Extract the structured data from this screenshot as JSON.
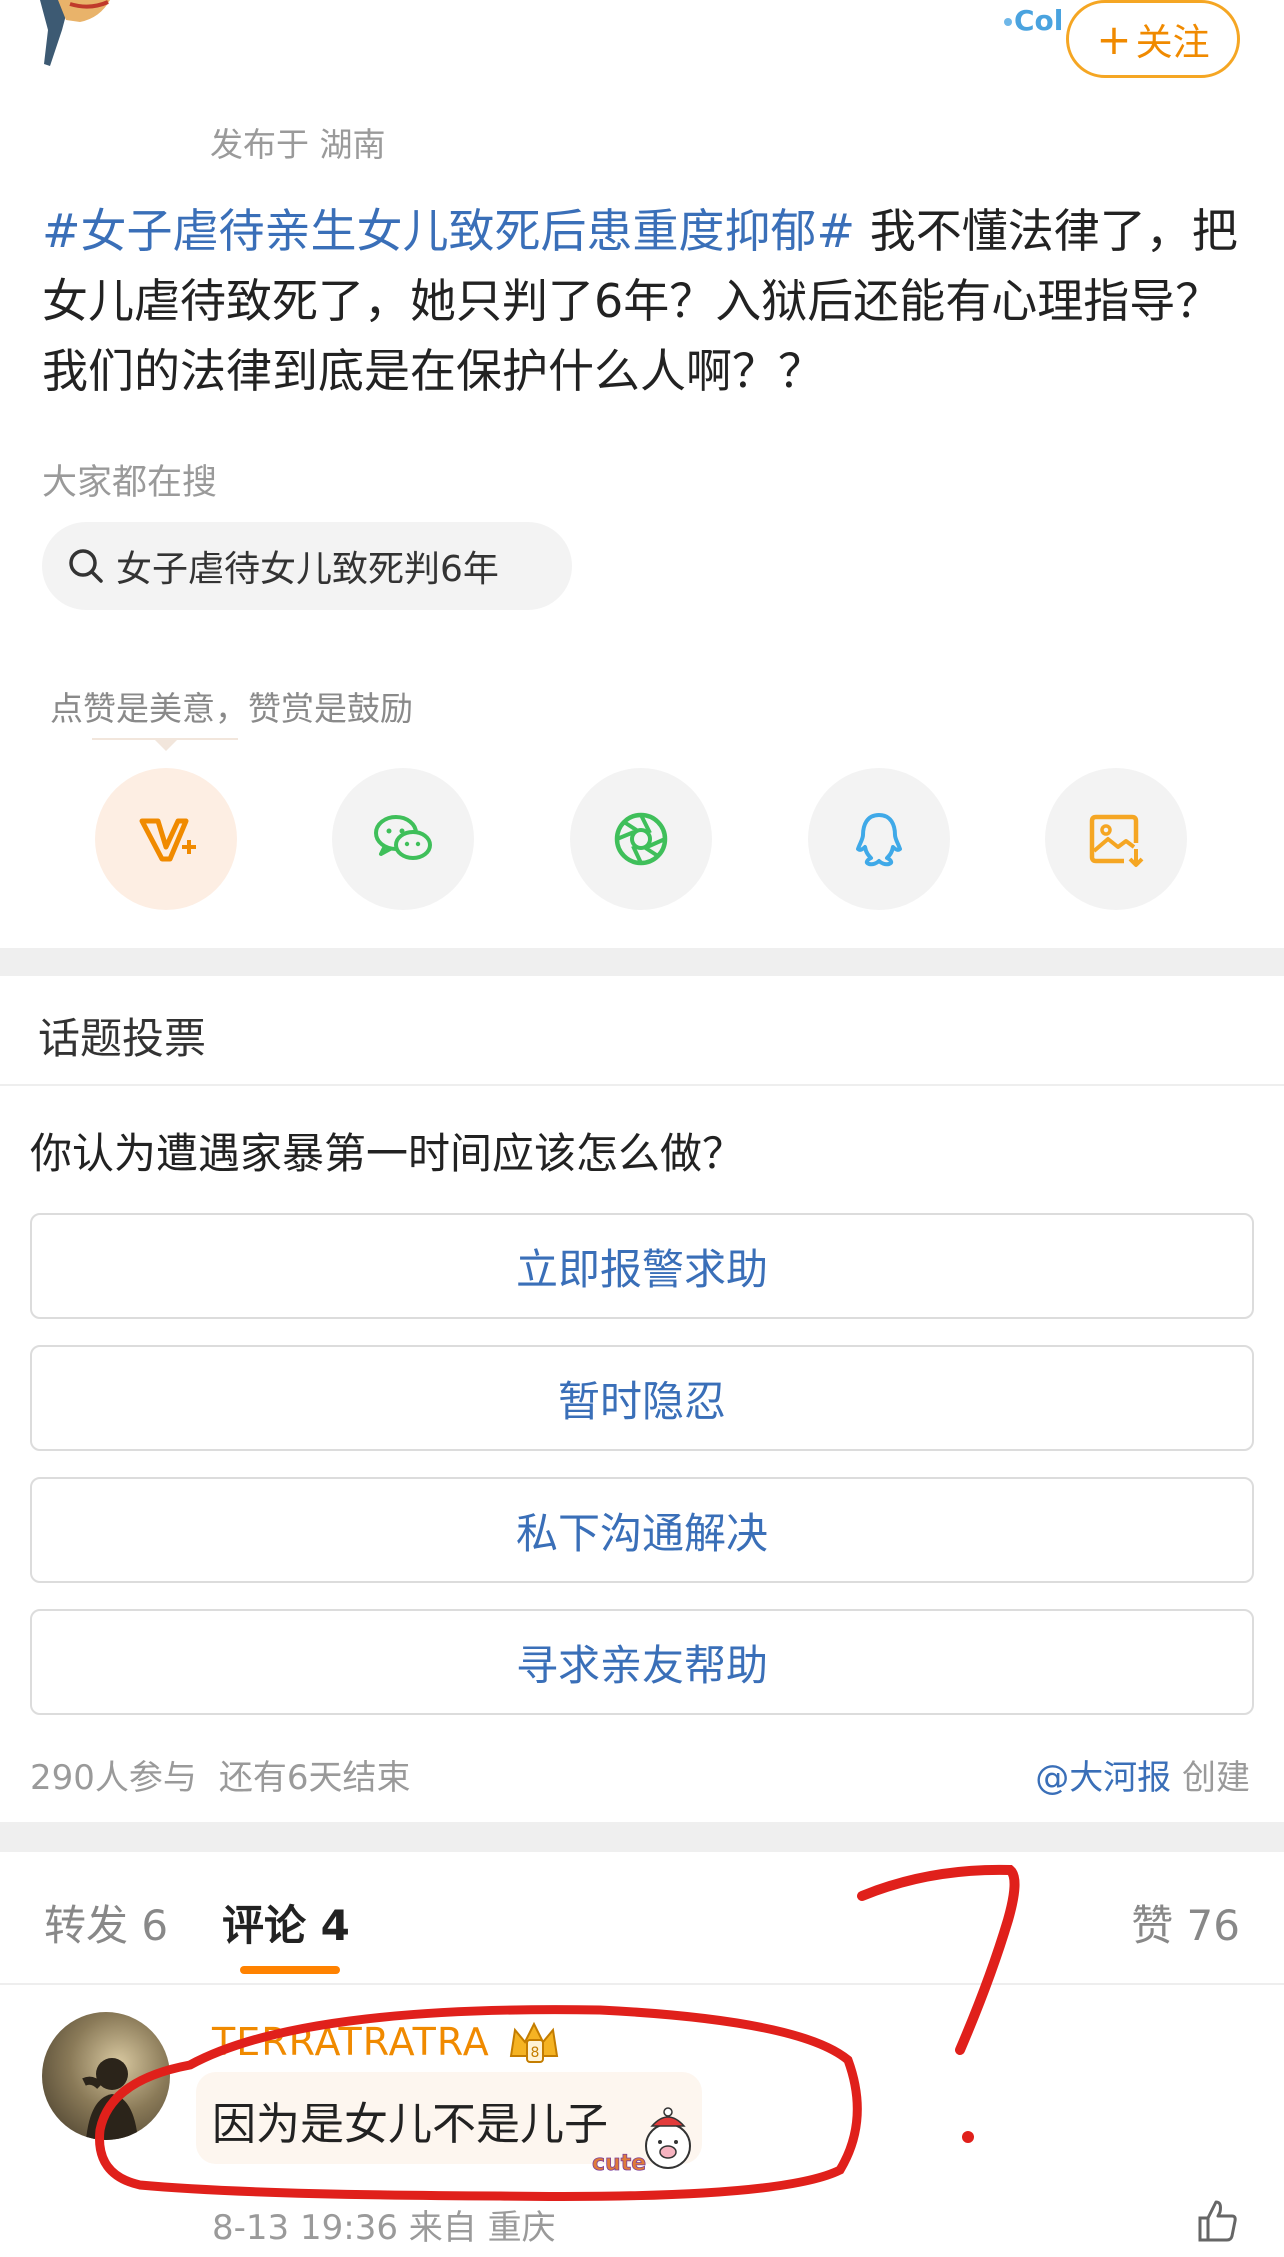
{
  "header": {
    "follow_label": "关注",
    "location": "发布于 湖南"
  },
  "post": {
    "topic": "#女子虐待亲生女儿致死后患重度抑郁#",
    "text": " 我不懂法律了，把女儿虐待致死了，她只判了6年？入狱后还能有心理指导？我们的法律到底是在保护什么人啊？？"
  },
  "search": {
    "label": "大家都在搜",
    "query": "女子虐待女儿致死判6年"
  },
  "reward": {
    "label": "点赞是美意，赞赏是鼓励"
  },
  "share_icons": [
    "reward-icon",
    "wechat-icon",
    "moments-icon",
    "qq-icon",
    "save-image-icon"
  ],
  "poll": {
    "title": "话题投票",
    "question": "你认为遭遇家暴第一时间应该怎么做？",
    "options": [
      "立即报警求助",
      "暂时隐忍",
      "私下沟通解决",
      "寻求亲友帮助"
    ],
    "participants": "290人参与",
    "remaining": "还有6天结束",
    "creator": "@大河报",
    "created_label": "创建"
  },
  "tabs": {
    "repost": "转发 6",
    "comments": "评论 4",
    "likes": "赞 76"
  },
  "comment": {
    "username": "TERRATRATRA",
    "text": "因为是女儿不是儿子",
    "sticker_label": "cute",
    "time": "8-13 19:36",
    "source": "来自 重庆"
  },
  "colors": {
    "accent": "#ff8200",
    "link": "#3a6fb8",
    "annotation": "#e0201b"
  }
}
